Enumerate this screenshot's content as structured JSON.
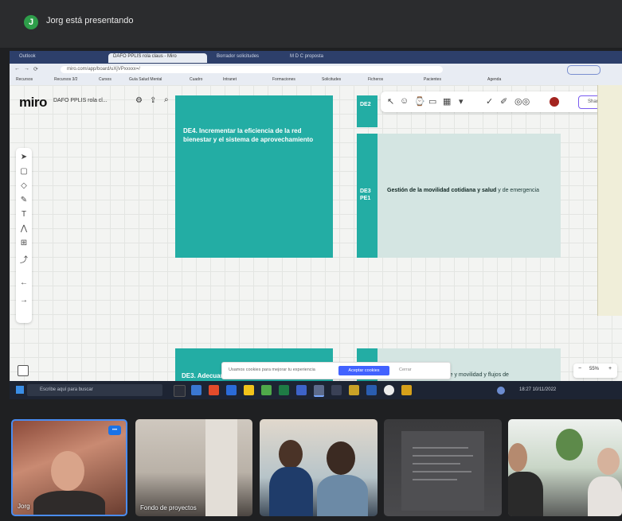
{
  "presenter": {
    "badge": "J",
    "text": "Jorg está presentando"
  },
  "browser": {
    "tabs": [
      {
        "label": "Outlook"
      },
      {
        "label": "DAFO PPLIS rola claus - Miro",
        "active": true
      },
      {
        "label": "Borrador solicitudes"
      },
      {
        "label": "M D C proposta"
      }
    ],
    "url": "miro.com/app/board/uXjVPxxxxx=/",
    "bookmarks": [
      "Recursos",
      "Recursos 3/2",
      "Cursos",
      "Guía Salud Mental",
      "Cuadro",
      "Intranet",
      "Formaciones",
      "Solicitudes",
      "Ficheros",
      "Pacientes",
      "Agenda"
    ]
  },
  "miro": {
    "logo": "miro",
    "board_name": "DAFO PPLIS rola cl...",
    "cards": {
      "card1_text": "DE4. Incrementar la eficiencia de la red bienestar y el sistema de aprovechamiento",
      "card2_top_label": "DE2",
      "card2_code": "DE3 PE1",
      "card2_text_bold": "Gestión de la movilidad cotidiana y salud",
      "card2_text_rest": " y de emergencia",
      "card3_text": "DE3. Adecuar",
      "card4_text": "Seguridad en el transporte y movilidad y flujos de"
    },
    "cookie": {
      "text": "Usamos cookies para mejorar tu experiencia",
      "button": "Aceptar cookies",
      "close": "Cerrar"
    },
    "zoom": {
      "minus": "−",
      "value": "55%",
      "plus": "+"
    },
    "share_label": "Share"
  },
  "taskbar": {
    "search_placeholder": "Escribe aquí para buscar",
    "tray_text": "18:27  10/11/2022"
  },
  "participants": [
    {
      "name": "Jorg",
      "more": "•••"
    },
    {
      "name": "Fondo de proyectos"
    },
    {
      "name": ""
    },
    {
      "name": ""
    },
    {
      "name": ""
    }
  ]
}
